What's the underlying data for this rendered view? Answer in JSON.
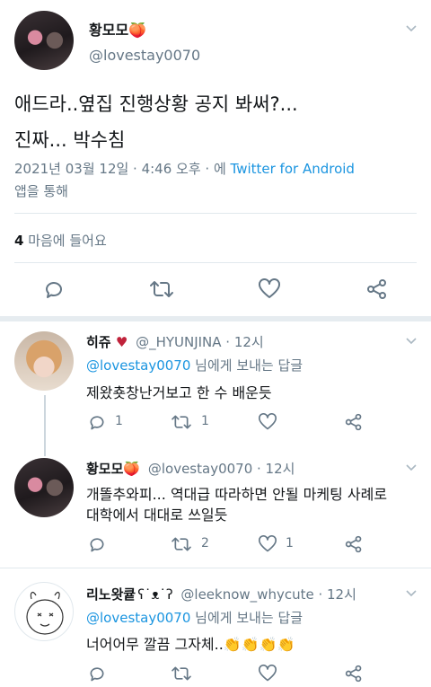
{
  "main_tweet": {
    "display_name": "황모모🍑",
    "handle": "@lovestay0070",
    "text_line1": "애드라..옆집 진행상황 공지 봐써?...",
    "text_line2": "진짜... 박수침",
    "meta_date": "2021년 03월 12일 · 4:46 오후 · 에 ",
    "meta_client": "Twitter for Android",
    "meta_suffix": "앱을 통해",
    "likes_count": "4",
    "likes_label": " 마음에 들어요"
  },
  "replies": [
    {
      "display_name": "히쥬 ",
      "heart": "♥",
      "handle_time": "@_HYUNJINA · 12시",
      "reply_to": "@lovestay0070",
      "reply_suffix": " 님에게 보내는 답글",
      "text": "제왔춋창난거보고 한 수 배운듯",
      "reply_count": "1",
      "retweet_count": "1",
      "like_count": ""
    },
    {
      "display_name": "황모모🍑",
      "handle_time": "@lovestay0070 · 12시",
      "text_line1": "개똘추와피... 역대급 따라하면 안될 마케팅 사례로",
      "text_line2": "대학에서 대대로 쓰일듯",
      "reply_count": "",
      "retweet_count": "2",
      "like_count": "1"
    },
    {
      "display_name": "리노왓큩",
      "handle_time": "@leeknow_whycute · 12시",
      "reply_to": "@lovestay0070",
      "reply_suffix": " 님에게 보내는 답글",
      "text": "너어어무 깔끔 그자체..👏👏👏👏"
    }
  ]
}
